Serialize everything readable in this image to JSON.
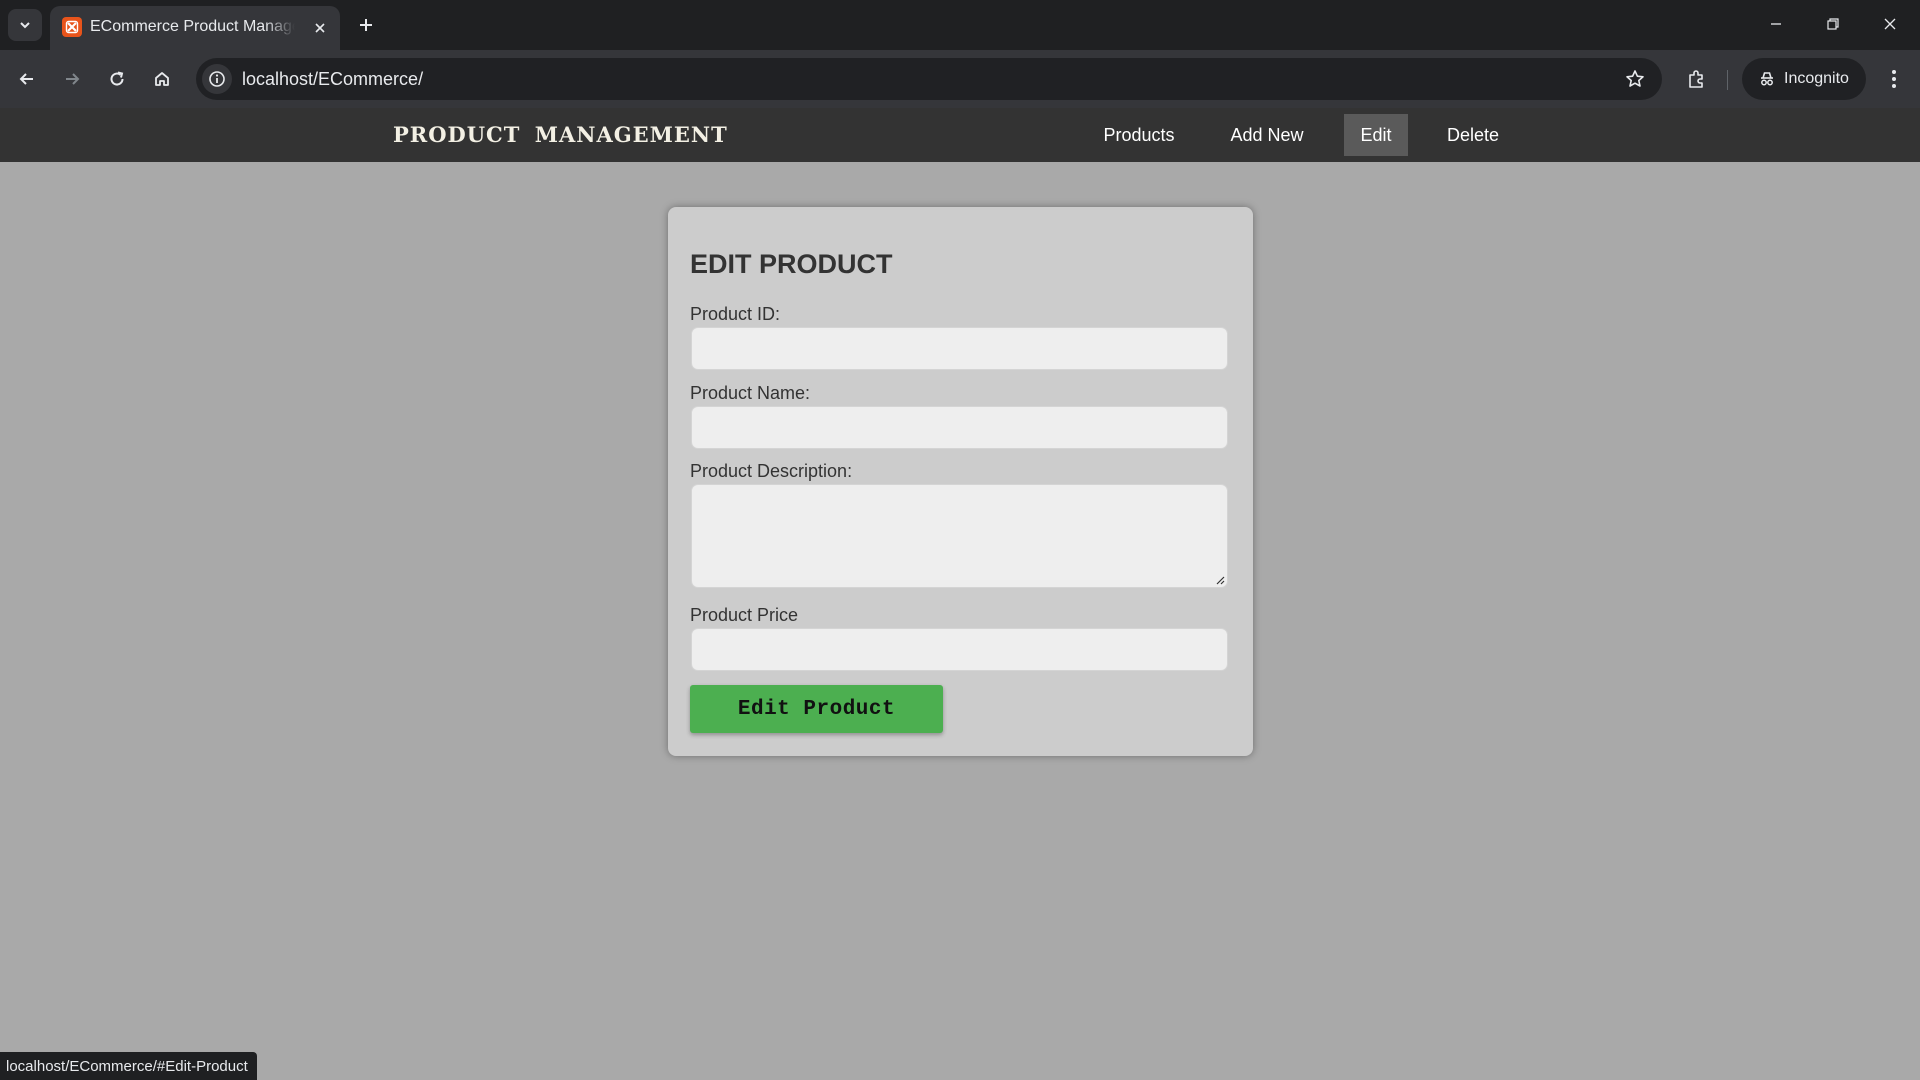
{
  "browser": {
    "tab_title": "ECommerce Product Management",
    "url": "localhost/ECommerce/",
    "profile_label": "Incognito",
    "status_url": "localhost/ECommerce/#Edit-Product"
  },
  "header": {
    "brand": "PRODUCT MANAGEMENT",
    "nav": [
      {
        "label": "Products",
        "active": false
      },
      {
        "label": "Add New",
        "active": false
      },
      {
        "label": "Edit",
        "active": true
      },
      {
        "label": "Delete",
        "active": false
      }
    ]
  },
  "form": {
    "title": "EDIT PRODUCT",
    "fields": [
      {
        "label": "Product ID:",
        "value": ""
      },
      {
        "label": "Product Name:",
        "value": ""
      },
      {
        "label": "Product Description:",
        "value": ""
      },
      {
        "label": "Product Price",
        "value": ""
      }
    ],
    "submit_label": "Edit Product"
  },
  "colors": {
    "page_bg": "#a9a9a9",
    "header_bg": "#333333",
    "active_nav_bg": "#5a5a5a",
    "card_bg": "#cccccc",
    "button_green": "#4caf50"
  },
  "icons": [
    "tab-list-icon",
    "favicon-icon",
    "close-icon",
    "plus-icon",
    "back-icon",
    "forward-icon",
    "reload-icon",
    "home-icon",
    "info-icon",
    "star-icon",
    "extensions-icon",
    "incognito-icon",
    "kebab-menu-icon",
    "minimize-icon",
    "restore-icon"
  ]
}
